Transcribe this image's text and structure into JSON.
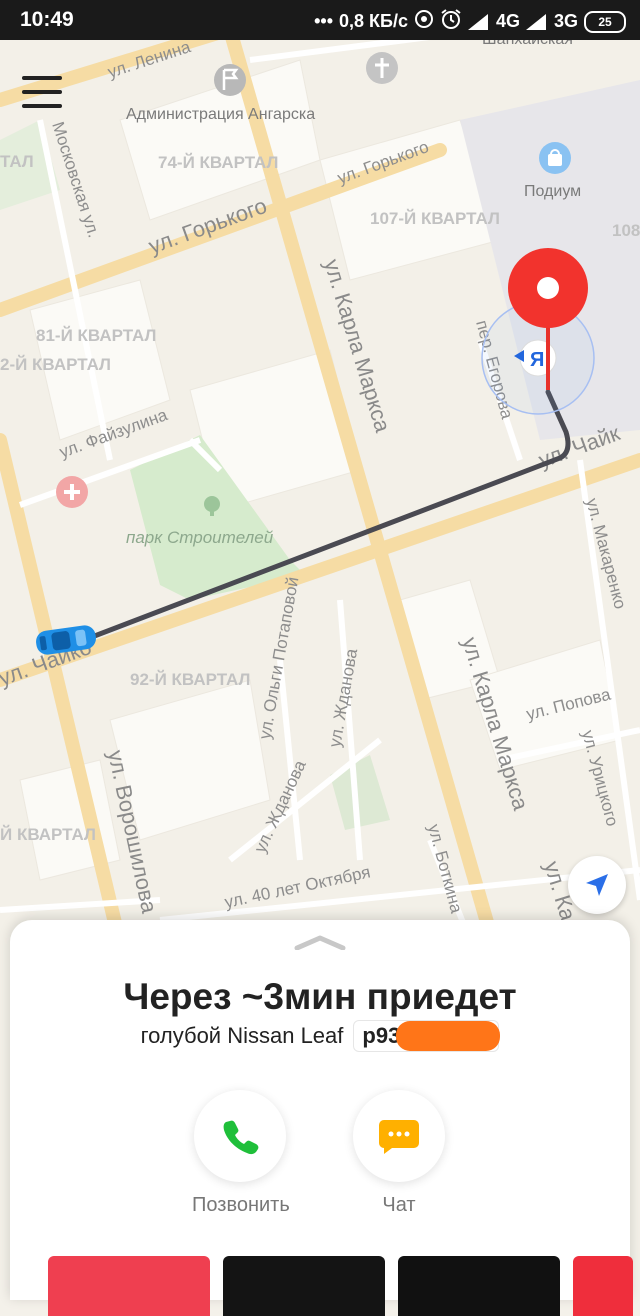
{
  "status_bar": {
    "time": "10:49",
    "net_speed": "0,8 КБ/с",
    "network_1": "4G",
    "network_2": "3G",
    "battery": "25",
    "dots": "•••"
  },
  "map": {
    "quarters": [
      "74-Й КВАРТАЛ",
      "107-Й КВАРТАЛ",
      "81-Й КВАРТАЛ",
      "2-Й КВАРТАЛ",
      "92-Й КВАРТАЛ",
      "Й КВАРТАЛ",
      "ТАЛ",
      "108"
    ],
    "streets": {
      "lenina": "ул. Ленина",
      "moskovskaya": "Московская ул.",
      "gorkogo_big": "ул. Горького",
      "gorkogo_small": "ул. Горького",
      "karla_marksa_1": "ул. Карла Маркса",
      "karla_marksa_2": "ул. Карла Маркса",
      "fayzulina": "ул. Файзулина",
      "chaykovskogo_left": "ул. Чайко",
      "chaykovskogo_right": "ул. Чайк",
      "olgi_potapovoy": "ул. Ольги Потаповой",
      "zhdanova_1": "ул. Жданова",
      "zhdanova_2": "ул. Жданова",
      "voroshilova": "ул. Ворошилова",
      "sorok_let": "ул. 40 лет Октября",
      "botkina": "ул. Боткина",
      "makarenko": "ул. Макаренко",
      "popova": "ул. Попова",
      "uritskogo": "ул. Урицкого",
      "egorova": "пер. Егорова",
      "karla_marksa_3": "ул. Ка"
    },
    "pois": {
      "admin": "Администрация Ангарска",
      "podium": "Подиум",
      "park": "парк Строителей",
      "top_cut": "Шанхайская"
    },
    "route_color": "#4a4a52",
    "pin_color": "#f2332d",
    "car_color": "#1f8fe6",
    "user_marker_letter": "Я",
    "user_marker_color": "#2266dd"
  },
  "sheet": {
    "eta_text": "Через ~3мин приедет",
    "car_desc": "голубой Nissan Leaf",
    "plate_prefix": "р93",
    "call_label": "Позвонить",
    "chat_label": "Чат",
    "call_icon_color": "#1fbf3a",
    "chat_icon_color": "#ffb000",
    "card_colors": [
      "#ef3f50",
      "#141414",
      "#111111",
      "#ef2e3c"
    ]
  }
}
